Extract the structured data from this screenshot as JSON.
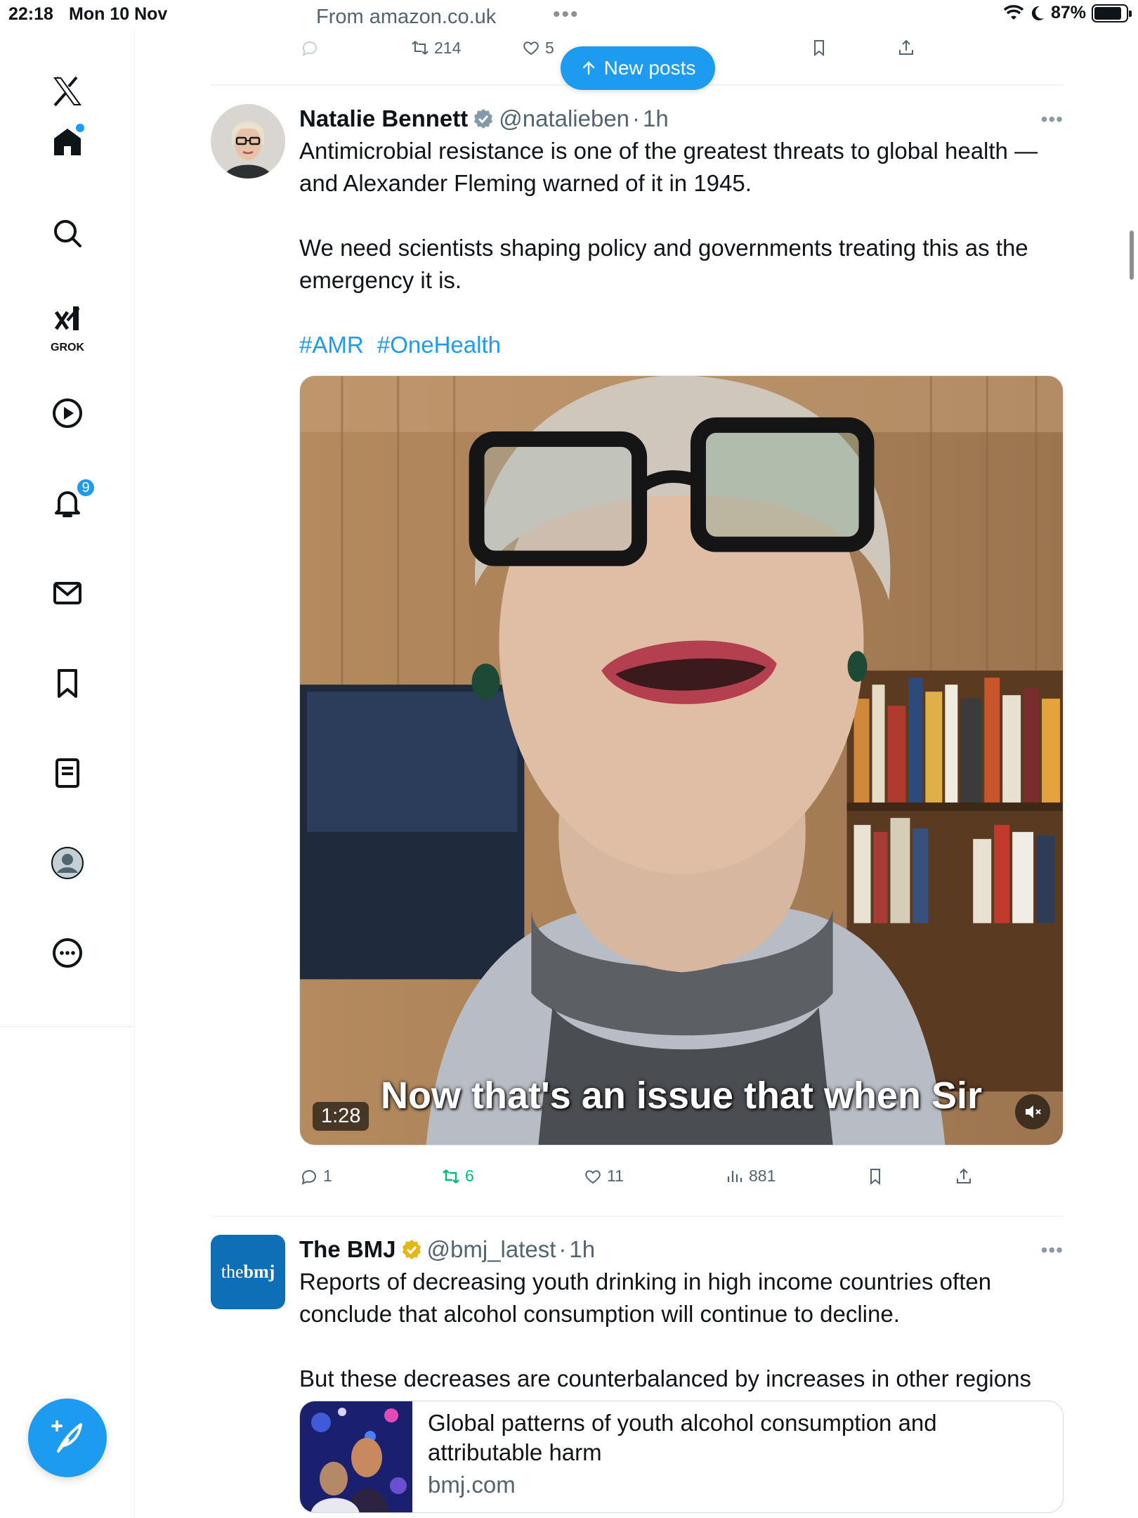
{
  "status_bar": {
    "time": "22:18",
    "date": "Mon 10 Nov",
    "source": "From amazon.co.uk",
    "battery": "87%",
    "battery_level": 0.87
  },
  "sidebar": {
    "grok_label": "GROK",
    "notifications_count": "9"
  },
  "top_actions": {
    "retweets": "214",
    "likes": "5"
  },
  "new_posts_label": "New posts",
  "tweets": [
    {
      "name": "Natalie Bennett",
      "handle": "@natalieben",
      "sep": "·",
      "time": "1h",
      "text1": "Antimicrobial resistance is one of the greatest threats to global health — and Alexander Fleming warned of it in 1945.",
      "text2": "We need scientists shaping policy and governments treating this as the emergency it is.",
      "hashtags": [
        "#AMR",
        "#OneHealth"
      ],
      "video": {
        "duration": "1:28",
        "caption": "Now that's an issue that when Sir"
      },
      "stats": {
        "replies": "1",
        "retweets": "6",
        "likes": "11",
        "views": "881"
      }
    },
    {
      "name": "The BMJ",
      "handle": "@bmj_latest",
      "sep": "·",
      "time": "1h",
      "avatar_text_1": "the",
      "avatar_text_2": "bmj",
      "text1": "Reports of decreasing youth drinking in high income countries often conclude that alcohol consumption will continue to decline.",
      "text2": "But these decreases are counterbalanced by increases in other regions",
      "link": {
        "title": "Global patterns of youth alcohol consumption and attributable harm",
        "domain": "bmj.com"
      }
    }
  ],
  "colors": {
    "accent": "#1d9bf0",
    "retweet_green": "#00ba7c",
    "muted": "#536471",
    "gold_verified": "#e2b719"
  }
}
